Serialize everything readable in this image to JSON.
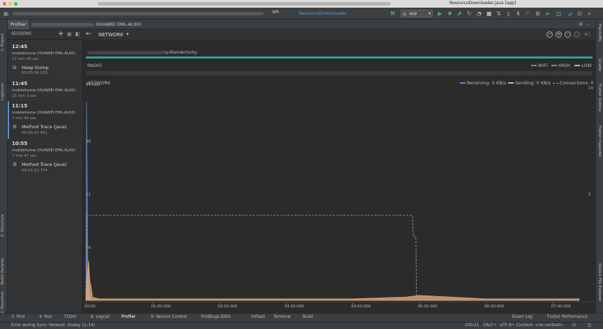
{
  "title_bar": {
    "project_title": "ResourceDownloader.java [app]",
    "toolbar_file_label": "ResourceDownloader"
  },
  "toolbar": {
    "run_config": "app"
  },
  "left_stripe": {
    "tabs": [
      "1: Project",
      "Captures",
      "2: Structure",
      "Build Variants",
      "2: Favorites"
    ]
  },
  "right_stripe": {
    "tabs": [
      "PlantUML",
      "Gradle",
      "Flutter Outline",
      "Flutter Inspector",
      "Device File Explorer"
    ]
  },
  "profiler": {
    "tab_label": "Profiler",
    "device_path": "(HUAWEI EML-AL00)"
  },
  "sessions": {
    "header": "SESSIONS",
    "items": [
      {
        "time": "12:45",
        "device": "mobilehome (HUAWEI EML-AL00)",
        "duration": "17 min 40 sec",
        "artifact": {
          "name": "Heap Dump",
          "duration": "00:00:04.103"
        }
      },
      {
        "time": "11:45",
        "device": "mobilehome (HUAWEI EML-AL00)",
        "duration": "15 min 3 sec"
      },
      {
        "time": "11:15",
        "device": "mobilehome (HUAWEI EML-AL00)",
        "duration": "7 min 40 sec",
        "artifact": {
          "name": "Method Trace (Java)",
          "duration": "00:00:47.401"
        }
      },
      {
        "time": "10:55",
        "device": "mobilehome (HUAWEI EML-AL00)",
        "duration": "7 min 47 sec",
        "artifact": {
          "name": "Method Trace (Java)",
          "duration": "00:01:12.774"
        }
      }
    ]
  },
  "network": {
    "section_title": "NETWORK",
    "activity": "ty.MainActivity",
    "radio": {
      "label": "RADIO",
      "legend": [
        "WIFI",
        "HIGH",
        "LOW"
      ]
    },
    "chart_label": "NETWORK",
    "legend": {
      "receiving": "Receiving: 0 KB/s",
      "sending": "Sending: 0 KB/s",
      "connections": "Connections: 0"
    },
    "colors": {
      "receiving": "#5c8fd6",
      "sending": "#f0b27a",
      "connections": "#aaaaaa",
      "activity": "#26a69a"
    }
  },
  "chart_data": {
    "type": "line",
    "y_left_label": "64 KB/s",
    "y_left_ticks": [
      "48",
      "32",
      "16"
    ],
    "y_right_ticks": [
      "10",
      "5"
    ],
    "ylim_left": [
      0,
      64
    ],
    "ylim_right": [
      0,
      10
    ],
    "x_tick_labels": [
      "00:00",
      "01:00.000",
      "02:00.000",
      "03:00.000",
      "04:00.000",
      "05:00.000",
      "06:00.000",
      "07:00.000"
    ],
    "x_minutes": [
      0,
      1,
      2,
      3,
      4,
      5,
      6,
      7
    ],
    "series": [
      {
        "name": "Receiving",
        "x": [
          0,
          0.01,
          0.02,
          0.03,
          0.05,
          0.08,
          0.5,
          7.4
        ],
        "values": [
          0,
          60,
          40,
          12,
          2,
          0,
          0,
          0
        ]
      },
      {
        "name": "Sending",
        "x": [
          0,
          0.02,
          0.04,
          0.06,
          0.08,
          0.1,
          0.2,
          1.0,
          2.0,
          3.0,
          4.0,
          4.8,
          5.0,
          6.0,
          7.0,
          7.4
        ],
        "values": [
          0,
          8,
          12,
          6,
          4,
          1,
          0.5,
          0.5,
          0.5,
          0.5,
          0.5,
          1,
          1.5,
          0.5,
          0.5,
          0.5
        ]
      },
      {
        "name": "Connections",
        "x": [
          0,
          0.01,
          4.9,
          4.91,
          4.95,
          4.96,
          7.4
        ],
        "values": [
          0,
          4,
          4,
          3,
          3,
          0,
          0
        ]
      }
    ]
  },
  "bottom_tools": {
    "tabs": [
      "3: Find",
      "4: Run",
      "TODO",
      "6: Logcat",
      "Profiler",
      "9: Version Control",
      "FindBugs-IDEA",
      "mPaaS",
      "Terminal",
      "Build",
      "Event Log",
      "Flutter Performance"
    ]
  },
  "status_bar": {
    "message": "Error during Sync: timeout. (today 11:14)",
    "position": "200:21",
    "line_sep": "CRLF÷",
    "encoding": "UTF-8÷",
    "context": "Context: <no context>"
  }
}
